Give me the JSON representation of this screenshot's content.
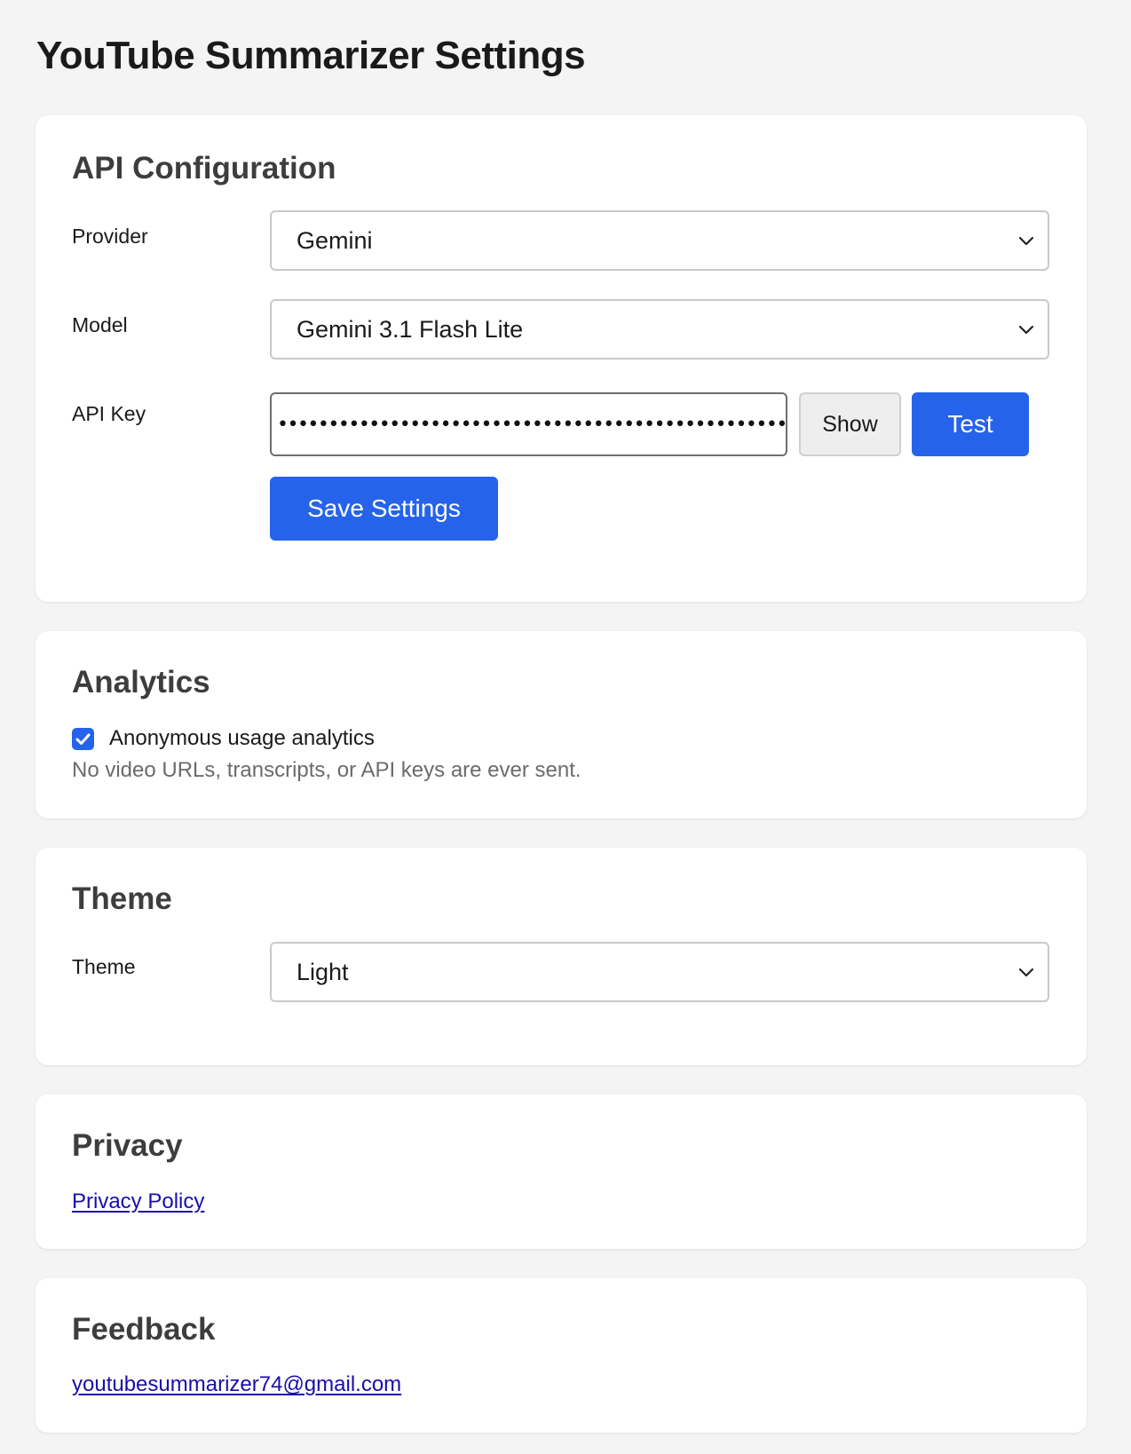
{
  "page": {
    "title": "YouTube Summarizer Settings"
  },
  "api_config": {
    "title": "API Configuration",
    "provider_label": "Provider",
    "provider_value": "Gemini",
    "model_label": "Model",
    "model_value": "Gemini 3.1 Flash Lite",
    "api_key_label": "API Key",
    "api_key_masked": "••••••••••••••••••••••••••••••••••••••••••••••••••",
    "show_label": "Show",
    "test_label": "Test",
    "save_label": "Save Settings"
  },
  "analytics": {
    "title": "Analytics",
    "checkbox_label": "Anonymous usage analytics",
    "checked": true,
    "note": "No video URLs, transcripts, or API keys are ever sent."
  },
  "theme": {
    "title": "Theme",
    "label": "Theme",
    "value": "Light"
  },
  "privacy": {
    "title": "Privacy",
    "link_label": "Privacy Policy"
  },
  "feedback": {
    "title": "Feedback",
    "email": "youtubesummarizer74@gmail.com"
  },
  "icons": {
    "select_chevron": "chevron-down-icon",
    "checkbox_check": "checkmark-icon"
  },
  "colors": {
    "accent": "#2563eb",
    "page_background": "#f4f4f4",
    "card_background": "#ffffff",
    "link": "#1a0dab"
  }
}
